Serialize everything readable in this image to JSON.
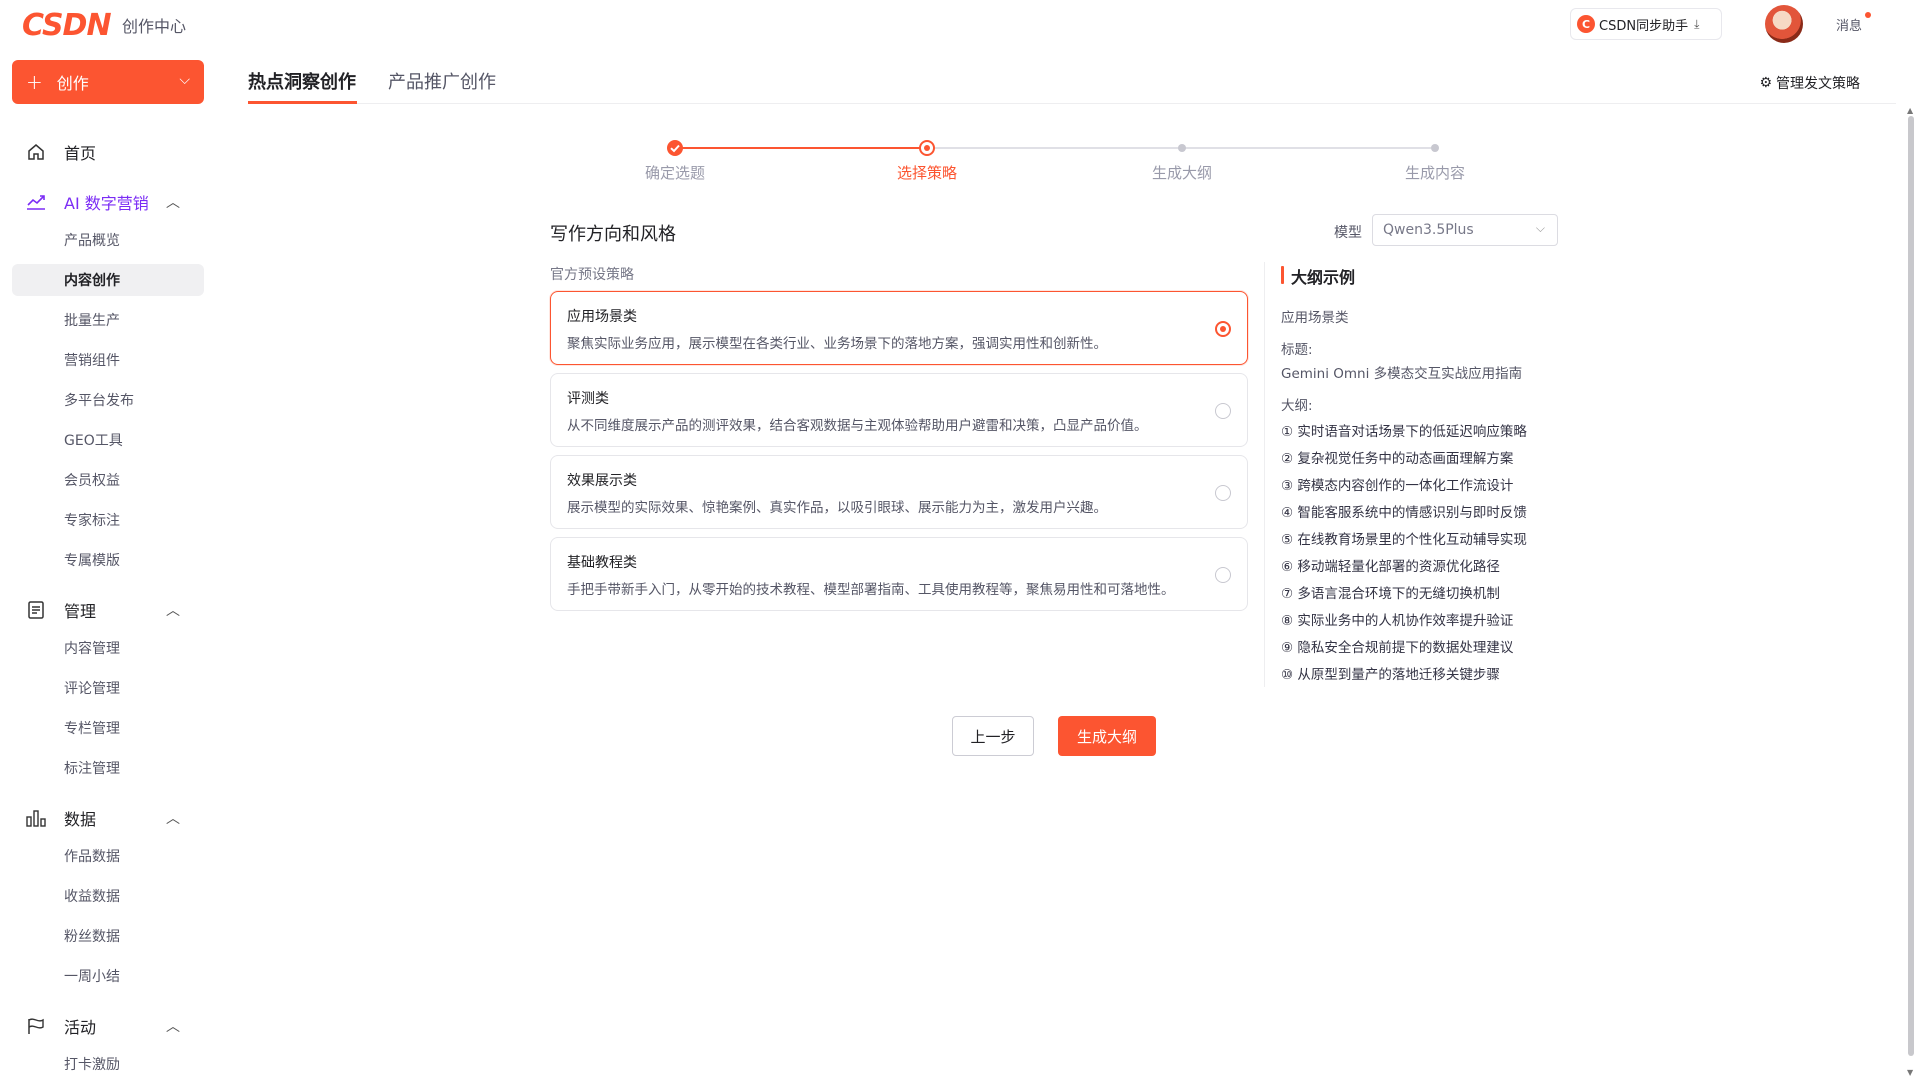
{
  "header": {
    "logo": "CSDN",
    "subtitle": "创作中心",
    "sync_button": "CSDN同步助手",
    "messages": "消息"
  },
  "sidebar": {
    "create_button": "创作",
    "home": "首页",
    "groups": [
      {
        "label": "AI 数字营销",
        "items": [
          "产品概览",
          "内容创作",
          "批量生产",
          "营销组件",
          "多平台发布",
          "GEO工具",
          "会员权益",
          "专家标注",
          "专属模版"
        ]
      },
      {
        "label": "管理",
        "items": [
          "内容管理",
          "评论管理",
          "专栏管理",
          "标注管理"
        ]
      },
      {
        "label": "数据",
        "items": [
          "作品数据",
          "收益数据",
          "粉丝数据",
          "一周小结"
        ]
      },
      {
        "label": "活动",
        "items": [
          "打卡激励"
        ]
      }
    ],
    "active_item": "内容创作"
  },
  "tabs": {
    "items": [
      "热点洞察创作",
      "产品推广创作"
    ],
    "active": "热点洞察创作",
    "manage_link": "管理发文策略"
  },
  "stepper": {
    "steps": [
      "确定选题",
      "选择策略",
      "生成大纲",
      "生成内容"
    ],
    "current_index": 1
  },
  "section": {
    "title": "写作方向和风格",
    "model_label": "模型",
    "model_value": "Qwen3.5Plus",
    "preset_label": "官方预设策略"
  },
  "strategies": [
    {
      "title": "应用场景类",
      "desc": "聚焦实际业务应用，展示模型在各类行业、业务场景下的落地方案，强调实用性和创新性。",
      "selected": true
    },
    {
      "title": "评测类",
      "desc": "从不同维度展示产品的测评效果，结合客观数据与主观体验帮助用户避雷和决策，凸显产品价值。",
      "selected": false
    },
    {
      "title": "效果展示类",
      "desc": "展示模型的实际效果、惊艳案例、真实作品，以吸引眼球、展示能力为主，激发用户兴趣。",
      "selected": false
    },
    {
      "title": "基础教程类",
      "desc": "手把手带新手入门，从零开始的技术教程、模型部署指南、工具使用教程等，聚焦易用性和可落地性。",
      "selected": false
    }
  ],
  "outline_example": {
    "title": "大纲示例",
    "category": "应用场景类",
    "heading_label": "标题:",
    "heading_value": "Gemini Omni 多模态交互实战应用指南",
    "outline_label": "大纲:",
    "items": [
      "① 实时语音对话场景下的低延迟响应策略",
      "② 复杂视觉任务中的动态画面理解方案",
      "③ 跨模态内容创作的一体化工作流设计",
      "④ 智能客服系统中的情感识别与即时反馈",
      "⑤ 在线教育场景里的个性化互动辅导实现",
      "⑥ 移动端轻量化部署的资源优化路径",
      "⑦ 多语言混合环境下的无缝切换机制",
      "⑧ 实际业务中的人机协作效率提升验证",
      "⑨ 隐私安全合规前提下的数据处理建议",
      "⑩ 从原型到量产的落地迁移关键步骤"
    ]
  },
  "actions": {
    "prev": "上一步",
    "next": "生成大纲"
  },
  "colors": {
    "accent": "#fc5531",
    "ai_purple": "#7b2cf5"
  }
}
